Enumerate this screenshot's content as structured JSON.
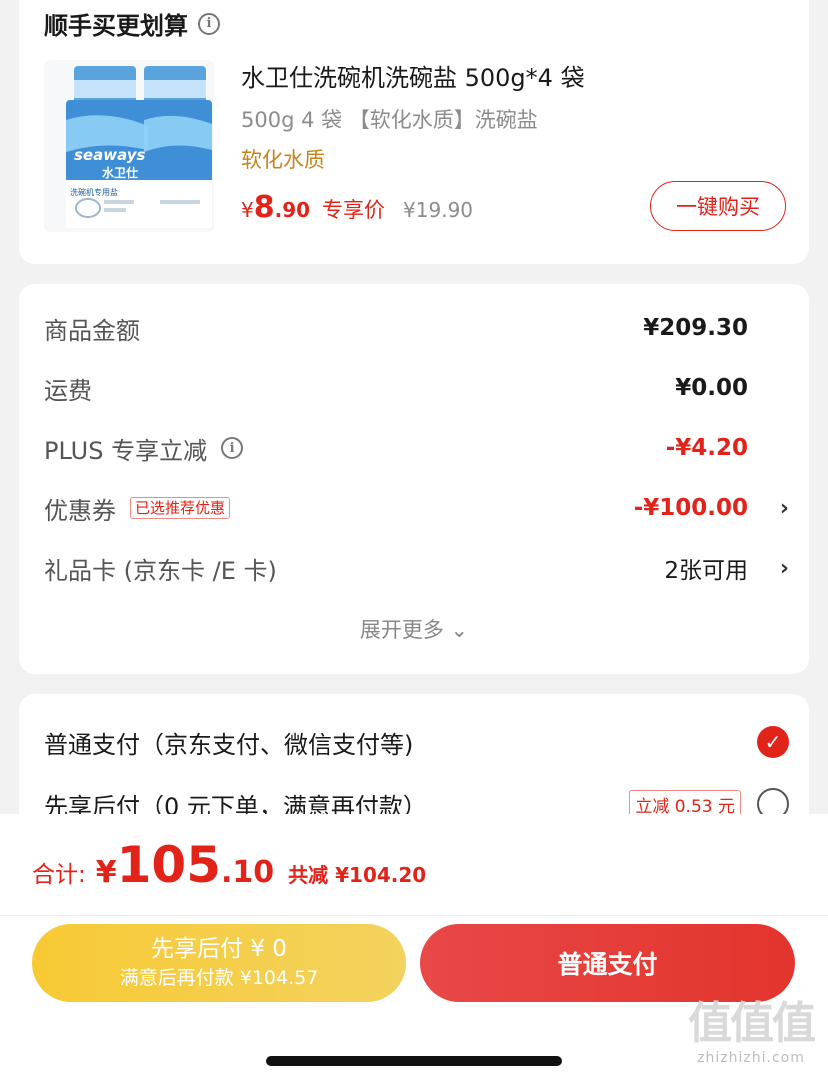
{
  "deal": {
    "title": "顺手买更划算",
    "info_icon": "i",
    "product": {
      "image_brand": "seaways",
      "image_name": "水卫仕",
      "image_subtitle": "洗碗机专用盐",
      "name": "水卫仕洗碗机洗碗盐 500g*4 袋",
      "spec": "500g 4 袋 【软化水质】洗碗盐",
      "tag": "软化水质",
      "price_symbol": "¥",
      "price_int": "8",
      "price_dec": ".90",
      "exclusive_label": "专享价",
      "original_price": "¥19.90",
      "buy_label": "一键购买"
    }
  },
  "summary": {
    "rows": [
      {
        "label": "商品金额",
        "value": "¥209.30"
      },
      {
        "label": "运费",
        "value": "¥0.00"
      },
      {
        "label": "PLUS 专享立减",
        "value": "-¥4.20",
        "info_icon": "i"
      },
      {
        "label": "优惠券",
        "badge": "已选推荐优惠",
        "value": "-¥100.00",
        "chevron": "›"
      },
      {
        "label": "礼品卡 (京东卡 /E 卡)",
        "value": "2张可用",
        "chevron": "›"
      }
    ],
    "expand_label": "展开更多 ⌄"
  },
  "payment": {
    "options": [
      {
        "label": "普通支付（京东支付、微信支付等)",
        "selected": true,
        "check": "✓"
      },
      {
        "label": "先享后付（0 元下单，满意再付款）",
        "selected": false,
        "badge": "立减 0.53 元"
      }
    ]
  },
  "bottom": {
    "total_label": "合计:",
    "total_symbol": "¥",
    "total_int": "105",
    "total_dec": ".10",
    "total_saved": "共减 ¥104.20",
    "later_line1": "先享后付 ¥ 0",
    "later_line2": "满意后再付款 ¥104.57",
    "normal_label": "普通支付"
  },
  "watermark": {
    "logo": "值值值",
    "url": "zhizhizhi.com"
  },
  "colors": {
    "accent_red": "#e2231a",
    "gold_tag": "#c9821e",
    "later_button": "#f7c934",
    "normal_button": "#e3342d"
  }
}
